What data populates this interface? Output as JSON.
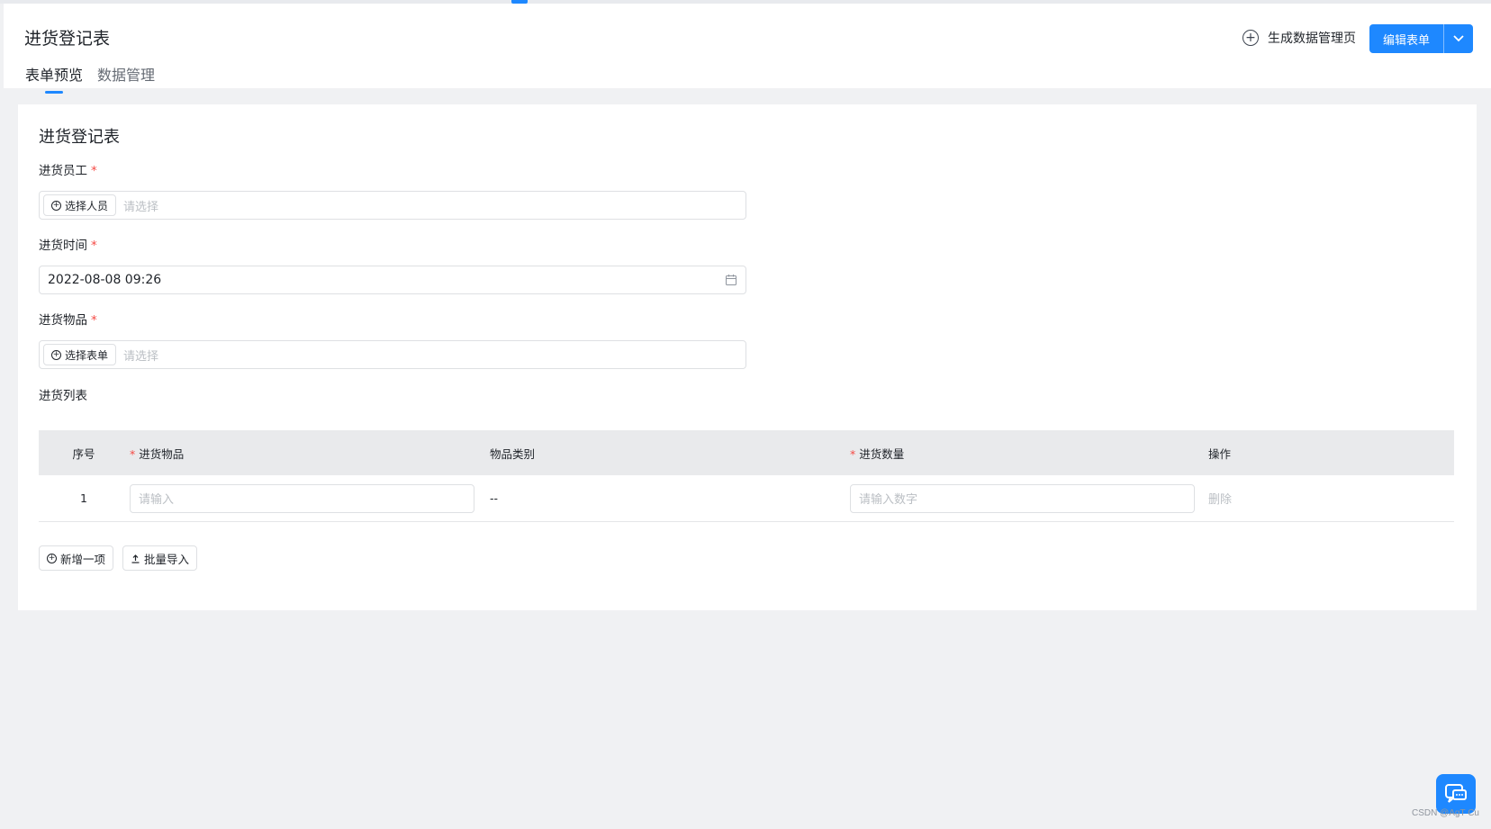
{
  "header": {
    "title": "进货登记表",
    "tabs": [
      {
        "label": "表单预览",
        "active": true
      },
      {
        "label": "数据管理",
        "active": false
      }
    ],
    "generate_link": "生成数据管理页",
    "edit_button": "编辑表单"
  },
  "form": {
    "title": "进货登记表",
    "fields": {
      "staff": {
        "label": "进货员工",
        "button": "选择人员",
        "placeholder": "请选择"
      },
      "time": {
        "label": "进货时间",
        "value": "2022-08-08 09:26"
      },
      "goods": {
        "label": "进货物品",
        "button": "选择表单",
        "placeholder": "请选择"
      }
    },
    "required_mark": "*"
  },
  "list": {
    "label": "进货列表",
    "columns": [
      "序号",
      "进货物品",
      "物品类别",
      "进货数量",
      "操作"
    ],
    "rows": [
      {
        "index": "1",
        "item_placeholder": "请输入",
        "category": "--",
        "qty_placeholder": "请输入数字",
        "action": "删除"
      }
    ],
    "add_button": "新增一项",
    "import_button": "批量导入"
  },
  "watermark": "CSDN @AgT Cu",
  "colors": {
    "accent": "#1e88ff",
    "required": "#f54a45"
  }
}
